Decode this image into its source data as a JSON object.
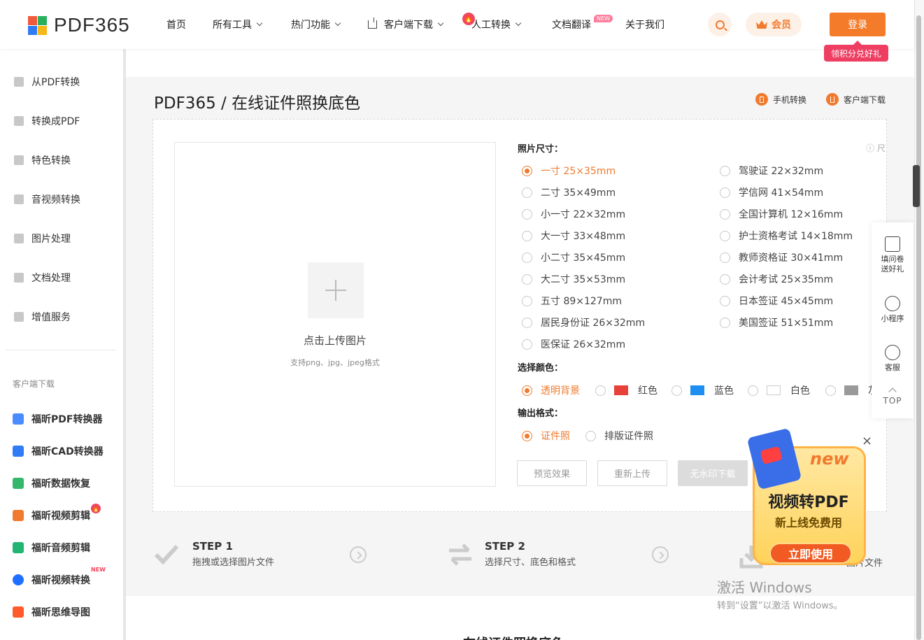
{
  "header": {
    "logo_text": "PDF365",
    "nav": [
      {
        "label": "首页"
      },
      {
        "label": "所有工具"
      },
      {
        "label": "热门功能"
      },
      {
        "label": "客户端下载"
      },
      {
        "label": "人工转换"
      },
      {
        "label": "文档翻译"
      },
      {
        "label": "关于我们"
      }
    ],
    "translate_badge": "NEW",
    "vip_label": "会员",
    "login_label": "登录",
    "promo_badge": "领积分兑好礼"
  },
  "sidebar": {
    "items": [
      {
        "label": "从PDF转换"
      },
      {
        "label": "转换成PDF"
      },
      {
        "label": "特色转换"
      },
      {
        "label": "音视频转换"
      },
      {
        "label": "图片处理"
      },
      {
        "label": "文档处理"
      },
      {
        "label": "增值服务"
      }
    ],
    "section_title": "客户端下载",
    "apps": [
      {
        "label": "福昕PDF转换器",
        "color": "#4a8cff"
      },
      {
        "label": "福昕CAD转换器",
        "color": "#2f7cf6"
      },
      {
        "label": "福昕数据恢复",
        "color": "#33b86b"
      },
      {
        "label": "福昕视频剪辑",
        "color": "#f07a2e"
      },
      {
        "label": "福昕音频剪辑",
        "color": "#22b573"
      },
      {
        "label": "福昕视频转换",
        "color": "#1f6fff"
      },
      {
        "label": "福昕思维导图",
        "color": "#ff5a2c"
      }
    ],
    "new_tag": "NEW"
  },
  "main": {
    "title": "PDF365 / 在线证件照换底色",
    "mobile_link": "手机转换",
    "client_link": "客户端下载",
    "upload": {
      "label": "点击上传图片",
      "hint": "支持png、jpg、jpeg格式"
    },
    "size_label": "照片尺寸：",
    "size_help": "尺",
    "sizes_left": [
      {
        "label": "一寸 25×35mm",
        "selected": true
      },
      {
        "label": "二寸 35×49mm"
      },
      {
        "label": "小一寸 22×32mm"
      },
      {
        "label": "大一寸 33×48mm"
      },
      {
        "label": "小二寸 35×45mm"
      },
      {
        "label": "大二寸 35×53mm"
      },
      {
        "label": "五寸 89×127mm"
      },
      {
        "label": "居民身份证 26×32mm"
      },
      {
        "label": "医保证 26×32mm"
      }
    ],
    "sizes_right": [
      {
        "label": "驾驶证 22×32mm"
      },
      {
        "label": "学信网 41×54mm"
      },
      {
        "label": "全国计算机 12×16mm"
      },
      {
        "label": "护士资格考试 14×18mm"
      },
      {
        "label": "教师资格证 30×41mm"
      },
      {
        "label": "会计考试 25×35mm"
      },
      {
        "label": "日本签证 45×45mm"
      },
      {
        "label": "美国签证 51×51mm"
      }
    ],
    "color_label": "选择颜色：",
    "colors": [
      {
        "label": "透明背景",
        "selected": true
      },
      {
        "label": "红色",
        "swatch": "#e8413a"
      },
      {
        "label": "蓝色",
        "swatch": "#1f8ef1"
      },
      {
        "label": "白色",
        "swatch": "#ffffff"
      },
      {
        "label": "灰",
        "swatch": "#9a9a9a"
      }
    ],
    "format_label": "输出格式：",
    "formats": [
      {
        "label": "证件照",
        "selected": true
      },
      {
        "label": "排版证件照"
      }
    ],
    "buttons": {
      "preview": "预览效果",
      "reupload": "重新上传",
      "download": "无水印下载"
    }
  },
  "steps": [
    {
      "title": "STEP 1",
      "desc": "拖拽或选择图片文件"
    },
    {
      "title": "STEP 2",
      "desc": "选择尺寸、底色和格式"
    },
    {
      "desc": "图片文件"
    }
  ],
  "float_bar": {
    "survey": "填问卷送好礼",
    "miniapp": "小程序",
    "service": "客服",
    "top": "TOP"
  },
  "promo": {
    "new": "new",
    "title": "视频转PDF",
    "subtitle": "新上线免费用",
    "cta": "立即使用",
    "close": "×"
  },
  "watermark": {
    "line1": "激活 Windows",
    "line2": "转到“设置”以激活 Windows。"
  },
  "bottom_text": "在线证件照换底色"
}
